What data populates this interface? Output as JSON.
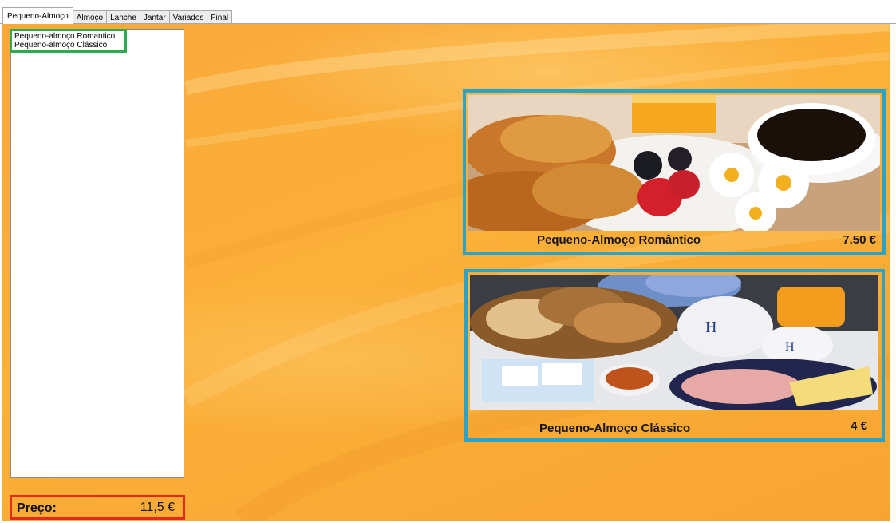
{
  "tabs": [
    {
      "label": "Pequeno-Almoço",
      "active": true
    },
    {
      "label": "Almoço",
      "active": false
    },
    {
      "label": "Lanche",
      "active": false
    },
    {
      "label": "Jantar",
      "active": false
    },
    {
      "label": "Variados",
      "active": false
    },
    {
      "label": "Final",
      "active": false
    }
  ],
  "order_list": {
    "items": [
      "Pequeno-almoço Romantico",
      "Pequeno-almoço Clássico"
    ]
  },
  "total": {
    "label": "Preço:",
    "value": "11,5 €"
  },
  "products": [
    {
      "name": "Pequeno-Almoço Romântico",
      "price": "7.50 €",
      "image_icon": "romantic-breakfast-photo"
    },
    {
      "name": "Pequeno-Almoço Clássico",
      "price": "4 €",
      "image_icon": "classic-breakfast-photo"
    }
  ],
  "colors": {
    "background": "#f9a83a",
    "card_border": "#2ba3c9",
    "list_highlight": "#2fa84f",
    "price_highlight": "#e22a1d"
  }
}
